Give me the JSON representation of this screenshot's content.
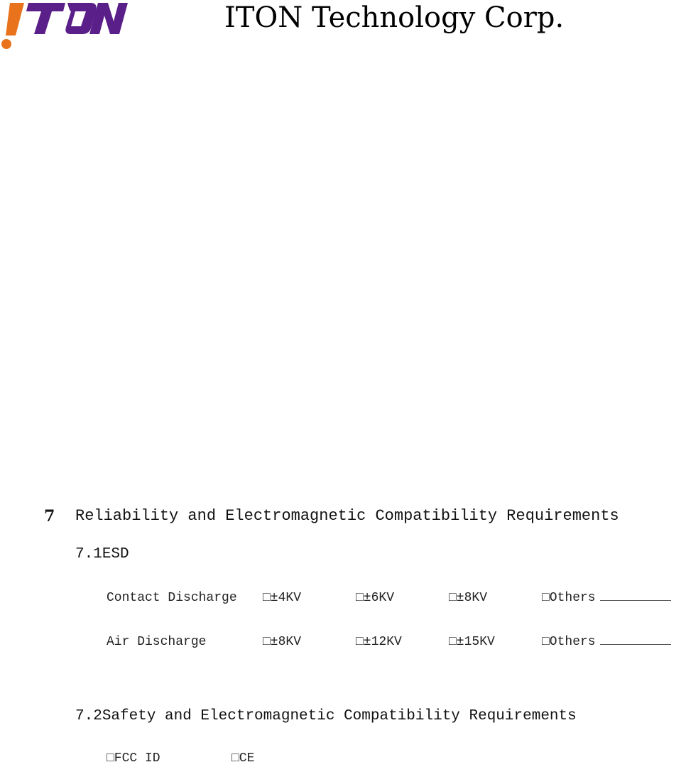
{
  "header": {
    "logo_text": "!TON",
    "company_name": "ITON Technology Corp."
  },
  "colors": {
    "logo_orange": "#e8731c",
    "logo_purple": "#5a1f88"
  },
  "section": {
    "number": "7",
    "title": "Reliability and Electromagnetic Compatibility Requirements"
  },
  "subsection_esd": {
    "number": "7.1",
    "title": "ESD",
    "rows": [
      {
        "label": "Contact Discharge",
        "options": [
          "□±4KV",
          "□±6KV",
          "□±8KV",
          "□Others"
        ]
      },
      {
        "label": "Air Discharge",
        "options": [
          "□±8KV",
          "□±12KV",
          "□±15KV",
          "□Others"
        ]
      }
    ]
  },
  "subsection_safety": {
    "number": "7.2",
    "title": "Safety and Electromagnetic Compatibility Requirements",
    "options": [
      "□FCC ID",
      "□CE"
    ]
  }
}
